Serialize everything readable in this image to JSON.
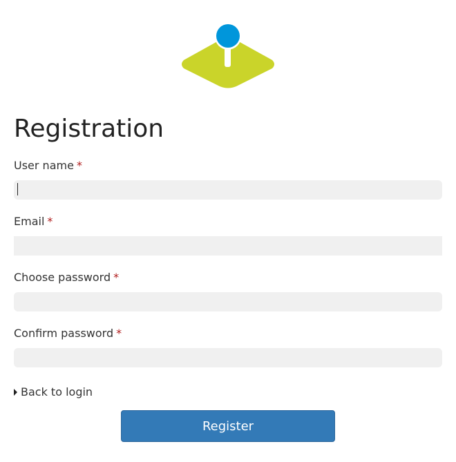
{
  "logo": {
    "icon": "map-pin-logo-icon",
    "colors": {
      "base": "#cad42a",
      "pin": "#0096db",
      "stem": "#ffffff"
    }
  },
  "page": {
    "title": "Registration"
  },
  "form": {
    "required_marker": "*",
    "fields": [
      {
        "label": "User name",
        "value": "",
        "type": "text"
      },
      {
        "label": "Email",
        "value": "",
        "type": "email"
      },
      {
        "label": "Choose password",
        "value": "",
        "type": "password"
      },
      {
        "label": "Confirm password",
        "value": "",
        "type": "password"
      }
    ]
  },
  "links": {
    "back_to_login": "Back to login",
    "back_icon": "caret-right-icon"
  },
  "actions": {
    "register_label": "Register",
    "register_color": "#337ab7"
  }
}
